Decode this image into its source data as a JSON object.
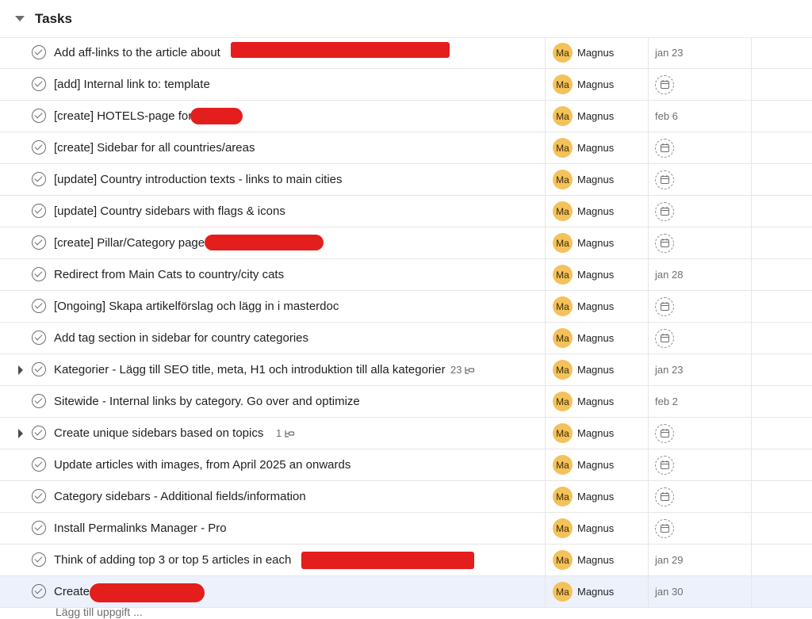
{
  "section": {
    "title": "Tasks"
  },
  "tasks": [
    {
      "name": "Add aff-links to the article about",
      "assignee_initials": "Ma",
      "assignee": "Magnus",
      "due": "jan 23",
      "expandable": false,
      "subtasks": ""
    },
    {
      "name": "[add] Internal link to: template",
      "assignee_initials": "Ma",
      "assignee": "Magnus",
      "due": "",
      "expandable": false,
      "subtasks": ""
    },
    {
      "name": "[create] HOTELS-page for",
      "assignee_initials": "Ma",
      "assignee": "Magnus",
      "due": "feb 6",
      "expandable": false,
      "subtasks": ""
    },
    {
      "name": "[create] Sidebar for all countries/areas",
      "assignee_initials": "Ma",
      "assignee": "Magnus",
      "due": "",
      "expandable": false,
      "subtasks": ""
    },
    {
      "name": "[update] Country introduction texts - links to main cities",
      "assignee_initials": "Ma",
      "assignee": "Magnus",
      "due": "",
      "expandable": false,
      "subtasks": ""
    },
    {
      "name": "[update] Country sidebars with flags & icons",
      "assignee_initials": "Ma",
      "assignee": "Magnus",
      "due": "",
      "expandable": false,
      "subtasks": ""
    },
    {
      "name": "[create] Pillar/Category page:",
      "assignee_initials": "Ma",
      "assignee": "Magnus",
      "due": "",
      "expandable": false,
      "subtasks": ""
    },
    {
      "name": "Redirect from Main Cats to country/city cats",
      "assignee_initials": "Ma",
      "assignee": "Magnus",
      "due": "jan 28",
      "expandable": false,
      "subtasks": ""
    },
    {
      "name": "[Ongoing] Skapa artikelförslag och lägg in i masterdoc",
      "assignee_initials": "Ma",
      "assignee": "Magnus",
      "due": "",
      "expandable": false,
      "subtasks": ""
    },
    {
      "name": "Add tag section in sidebar for country categories",
      "assignee_initials": "Ma",
      "assignee": "Magnus",
      "due": "",
      "expandable": false,
      "subtasks": ""
    },
    {
      "name": "Kategorier - Lägg till SEO title, meta, H1 och introduktion till alla kategorier",
      "assignee_initials": "Ma",
      "assignee": "Magnus",
      "due": "jan 23",
      "expandable": true,
      "subtasks": "23"
    },
    {
      "name": "Sitewide - Internal links by category. Go over and optimize",
      "assignee_initials": "Ma",
      "assignee": "Magnus",
      "due": "feb 2",
      "expandable": false,
      "subtasks": ""
    },
    {
      "name": "Create unique sidebars based on topics",
      "assignee_initials": "Ma",
      "assignee": "Magnus",
      "due": "",
      "expandable": true,
      "subtasks": "1"
    },
    {
      "name": "Update articles with images, from April 2025 an onwards",
      "assignee_initials": "Ma",
      "assignee": "Magnus",
      "due": "",
      "expandable": false,
      "subtasks": ""
    },
    {
      "name": "Category sidebars - Additional fields/information",
      "assignee_initials": "Ma",
      "assignee": "Magnus",
      "due": "",
      "expandable": false,
      "subtasks": ""
    },
    {
      "name": "Install Permalinks Manager - Pro",
      "assignee_initials": "Ma",
      "assignee": "Magnus",
      "due": "",
      "expandable": false,
      "subtasks": ""
    },
    {
      "name": "Think of adding top 3 or top 5 articles in each",
      "assignee_initials": "Ma",
      "assignee": "Magnus",
      "due": "jan 29",
      "expandable": false,
      "subtasks": ""
    },
    {
      "name": "Create",
      "assignee_initials": "Ma",
      "assignee": "Magnus",
      "due": "jan 30",
      "expandable": false,
      "subtasks": "",
      "selected": true
    }
  ],
  "add_task": {
    "label": "Lägg till uppgift ..."
  },
  "colors": {
    "avatar": "#f4c25b",
    "redaction": "#e41d1d",
    "selected_row": "#edf1fb"
  }
}
